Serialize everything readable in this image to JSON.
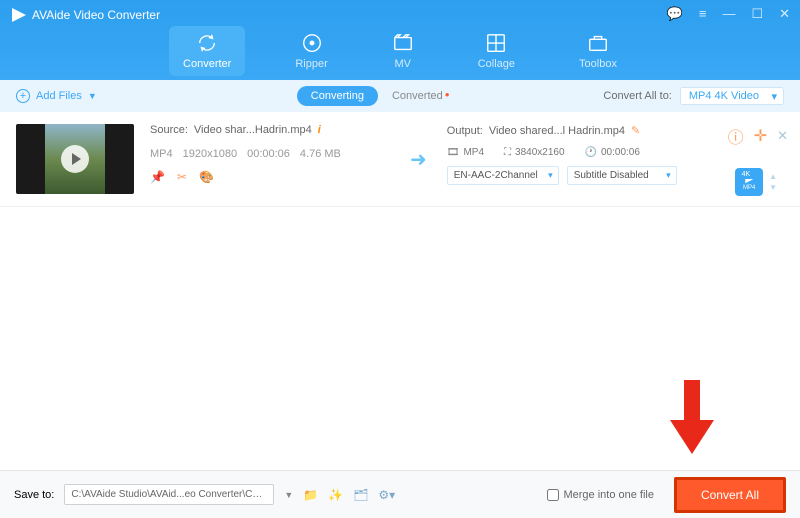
{
  "app": {
    "title": "AVAide Video Converter"
  },
  "nav": [
    {
      "label": "Converter"
    },
    {
      "label": "Ripper"
    },
    {
      "label": "MV"
    },
    {
      "label": "Collage"
    },
    {
      "label": "Toolbox"
    }
  ],
  "subbar": {
    "add_files": "Add Files",
    "tab_converting": "Converting",
    "tab_converted": "Converted",
    "convert_all_to": "Convert All to:",
    "format": "MP4 4K Video"
  },
  "file": {
    "source_label": "Source:",
    "source_name": "Video shar...Hadrin.mp4",
    "container": "MP4",
    "resolution": "1920x1080",
    "duration": "00:00:06",
    "size": "4.76 MB",
    "output_label": "Output:",
    "output_name": "Video shared...l Hadrin.mp4",
    "out_container": "MP4",
    "out_resolution": "3840x2160",
    "out_duration": "00:00:06",
    "audio_select": "EN-AAC-2Channel",
    "subtitle_select": "Subtitle Disabled",
    "hd_badge": "4K",
    "format_badge": "MP4"
  },
  "footer": {
    "save_to_label": "Save to:",
    "save_path": "C:\\AVAide Studio\\AVAid...eo Converter\\Converted",
    "merge_label": "Merge into one file",
    "convert_btn": "Convert All"
  }
}
